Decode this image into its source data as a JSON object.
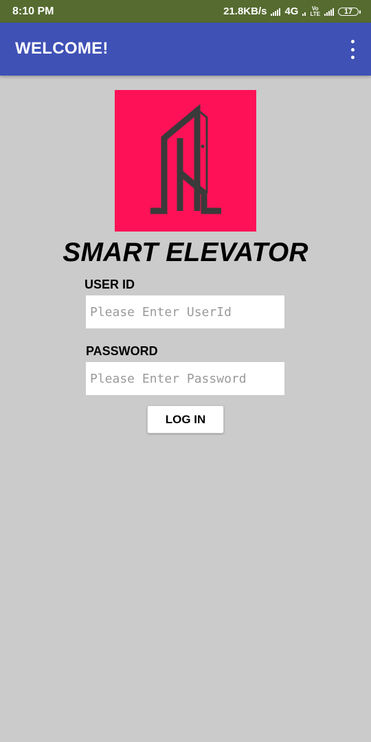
{
  "status_bar": {
    "time": "8:10 PM",
    "network_speed": "21.8KB/s",
    "network_type": "4G",
    "volte_top": "Vo",
    "volte_bottom": "LTE",
    "battery_level": "17",
    "icons": [
      "signal-icon",
      "volte-icon",
      "battery-icon"
    ]
  },
  "app_bar": {
    "title": "WELCOME!",
    "menu_icon": "more-vert-icon",
    "background": "#3f51b5"
  },
  "logo": {
    "icon": "building-logo-icon",
    "background": "#ff1157"
  },
  "brand": {
    "title": "SMART ELEVATOR"
  },
  "form": {
    "user_id_label": "USER ID",
    "user_id_placeholder": "Please Enter UserId",
    "user_id_value": "",
    "password_label": "PASSWORD",
    "password_placeholder": "Please Enter Password",
    "password_value": "",
    "login_label": "LOG IN"
  }
}
